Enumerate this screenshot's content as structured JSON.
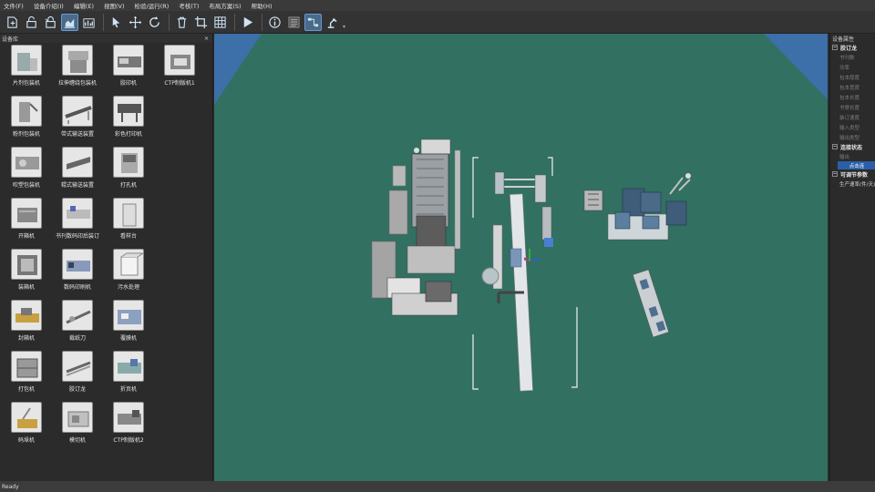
{
  "menu": [
    "文件(F)",
    "设备介绍(I)",
    "编辑(E)",
    "视图(V)",
    "检验/运行(R)",
    "考核(T)",
    "布局方案(S)",
    "帮助(H)"
  ],
  "left_panel": {
    "title": "设备库",
    "close": "×",
    "equipment": [
      "片剂包装机",
      "拉伸缠绕包装机",
      "胶印机",
      "CTP制版机1",
      "粉剂包装机",
      "带式输送装置",
      "彩色打印机",
      "吹塑包装机",
      "辊式输送装置",
      "打孔机",
      "开箱机",
      "书刊数码印后装订",
      "看样台",
      "装箱机",
      "数码印刷机",
      "污水处理",
      "封箱机",
      "裁纸刀",
      "覆膜机",
      "打包机",
      "胶订龙",
      "折页机",
      "码垛机",
      "模切机",
      "CTP制版机2"
    ]
  },
  "right_panel": {
    "title": "设备属性",
    "sections": [
      {
        "name": "胶订龙",
        "rows": [
          "书刊数",
          "功率",
          "包本厚度",
          "包本宽度",
          "包本长度",
          "书脊长度",
          "装订速度",
          "输入类型",
          "输出类型"
        ]
      },
      {
        "name": "连接状态",
        "rows": [
          "输出"
        ],
        "button": "点击连"
      },
      {
        "name": "可调节参数",
        "rows": [
          "生产速率(件/天)"
        ]
      }
    ]
  },
  "status": "Ready",
  "colors": {
    "floor": "#327062",
    "sky": "#3d6fa8",
    "accent": "#2a5fa8"
  }
}
